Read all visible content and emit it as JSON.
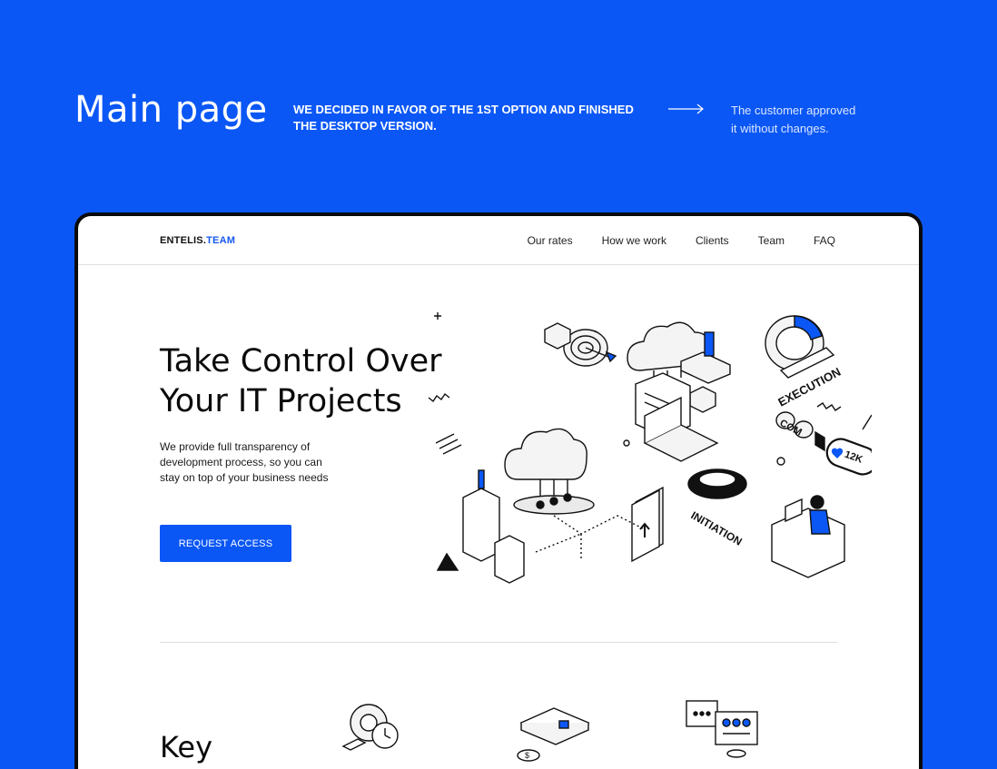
{
  "header": {
    "title": "Main page",
    "note": "WE DECIDED IN FAVOR OF THE 1ST OPTION AND FINISHED THE DESKTOP VERSION.",
    "result_line1": "The customer approved",
    "result_line2": "it without changes."
  },
  "site": {
    "logo_prefix": "ENTELIS.",
    "logo_suffix": "TEAM",
    "nav": [
      "Our rates",
      "How we work",
      "Clients",
      "Team",
      "FAQ"
    ],
    "hero_title_line1": "Take Control Over",
    "hero_title_line2": "Your IT Projects",
    "hero_text": "We provide full transparency of development process, so you can stay on top of your business needs",
    "cta_label": "REQUEST ACCESS",
    "section_title": "Key"
  },
  "illustration": {
    "execution_label": "EXECUTION",
    "initiation_label": "INITIATION",
    "counter_label": "12K",
    "com_label": "COM",
    "icons": [
      "cloud-icon",
      "laptop-icon",
      "phone-upload-icon",
      "target-icon",
      "server-icon",
      "worker-at-desk-icon"
    ]
  },
  "features": {
    "icons": [
      "gear-clock-icon",
      "wallet-coin-icon",
      "chat-monitor-icon"
    ]
  },
  "colors": {
    "brand_blue": "#0b57f5",
    "dark": "#0a0a0a"
  }
}
